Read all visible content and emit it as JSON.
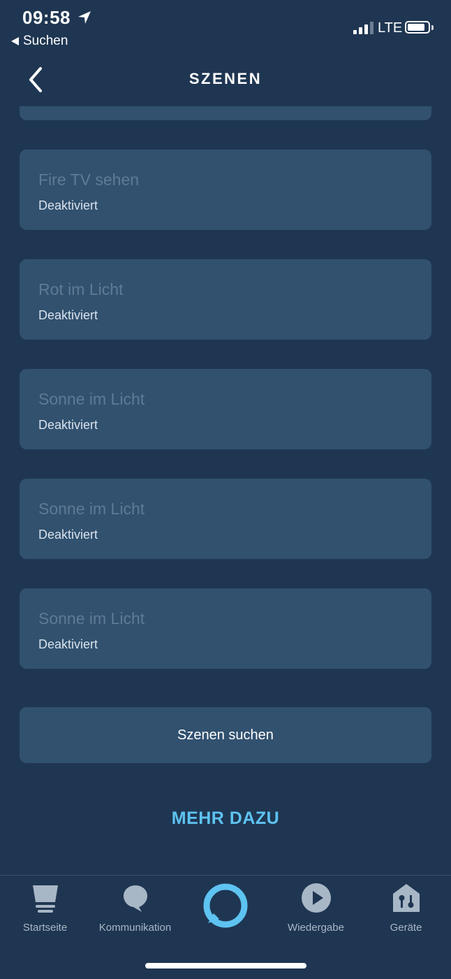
{
  "status_bar": {
    "time": "09:58",
    "back_app": "Suchen",
    "network": "LTE"
  },
  "header": {
    "title": "SZENEN"
  },
  "scenes": [
    {
      "name": "Fire TV sehen",
      "status": "Deaktiviert"
    },
    {
      "name": "Rot im Licht",
      "status": "Deaktiviert"
    },
    {
      "name": "Sonne im Licht",
      "status": "Deaktiviert"
    },
    {
      "name": "Sonne im Licht",
      "status": "Deaktiviert"
    },
    {
      "name": "Sonne im Licht",
      "status": "Deaktiviert"
    }
  ],
  "actions": {
    "search_button": "Szenen suchen",
    "more_link": "MEHR DAZU"
  },
  "tabbar": {
    "items": [
      {
        "label": "Startseite",
        "icon": "home-icon"
      },
      {
        "label": "Kommunikation",
        "icon": "chat-bubble-icon"
      },
      {
        "label": "",
        "icon": "alexa-icon"
      },
      {
        "label": "Wiedergabe",
        "icon": "play-icon"
      },
      {
        "label": "Geräte",
        "icon": "devices-icon"
      }
    ]
  },
  "colors": {
    "background": "#1f3652",
    "card": "#31516f",
    "accent": "#5ec3f1",
    "disabled_text": "#5f7a95"
  }
}
